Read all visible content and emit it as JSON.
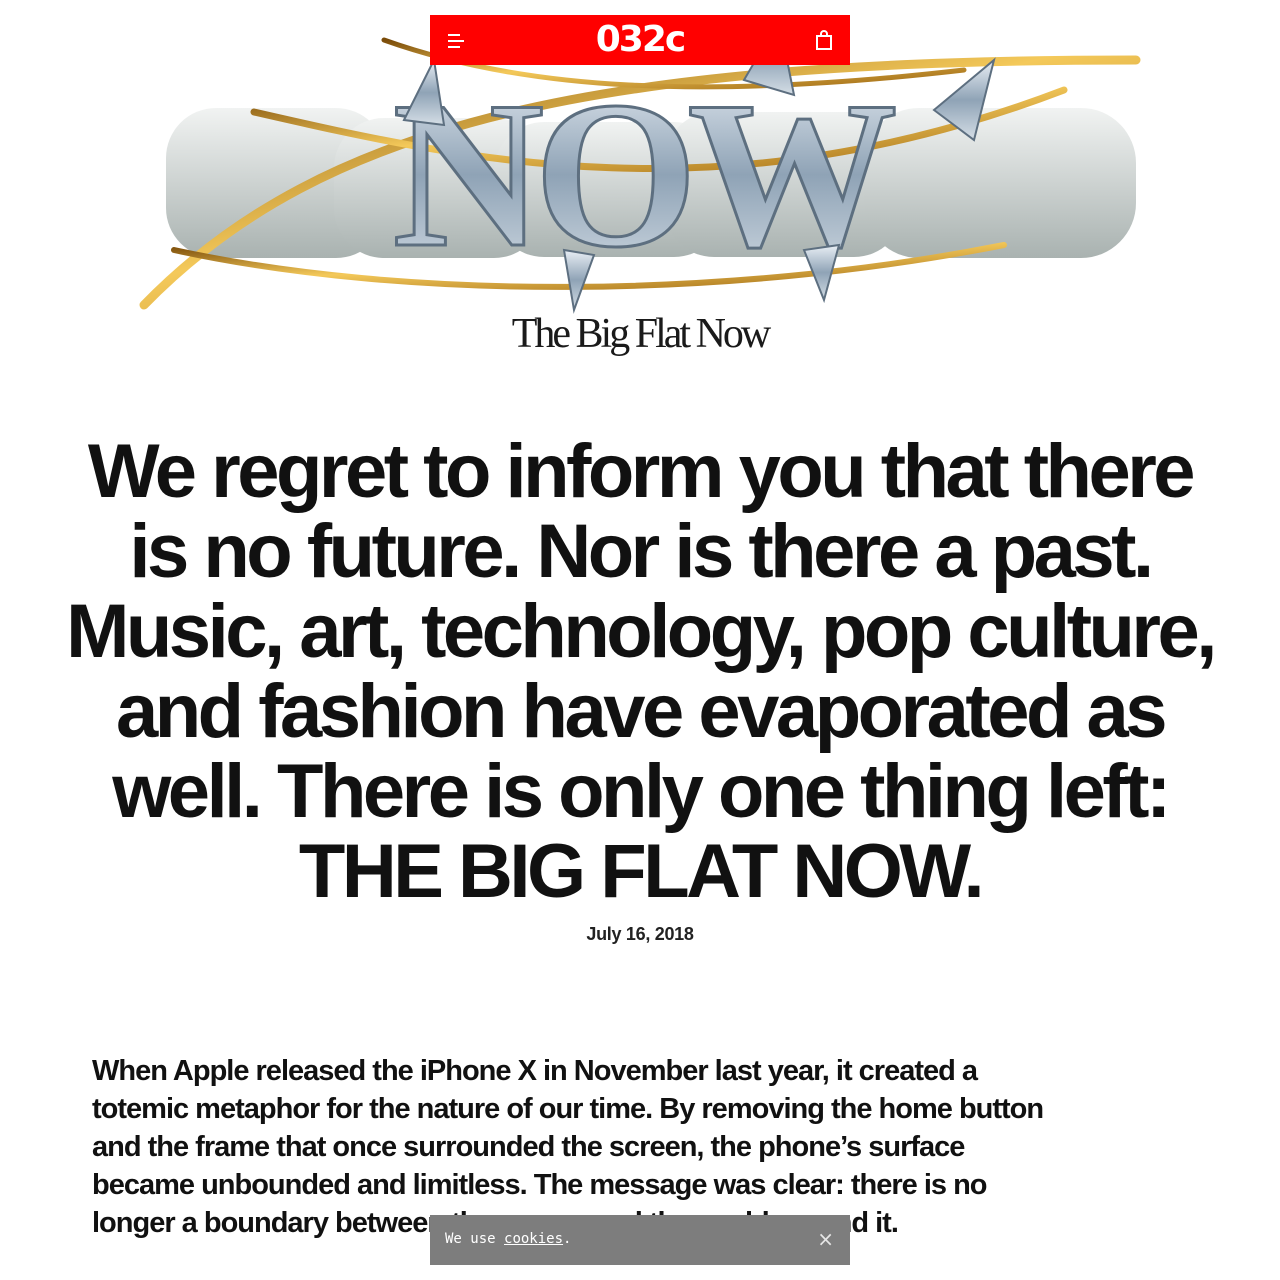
{
  "nav": {
    "logo": "032c",
    "menu_icon": "hamburger-menu-icon",
    "cart_icon": "shopping-bag-icon",
    "bar_color": "#ff0000"
  },
  "hero": {
    "artwork_text": "NOW",
    "subtitle": "The Big Flat Now"
  },
  "article": {
    "headline_lines": [
      "We regret to inform you that there",
      "is no future. Nor is there a past.",
      "Music, art, technology, pop culture,",
      "and fashion have evaporated as",
      "well. There is only one thing left:",
      "THE BIG FLAT NOW."
    ],
    "date": "July 16, 2018",
    "body_lines": [
      "When Apple released the iPhone X in November last year, it created a",
      "totemic metaphor for the nature of our time. By removing the home button",
      "and the frame that once surrounded the screen, the phone’s surface",
      "became unbounded and limitless. The message was clear: there is no",
      "longer a boundary between the screen and the world around it."
    ]
  },
  "cookie_banner": {
    "text_prefix": "We use ",
    "link_text": "cookies",
    "text_suffix": ".",
    "close_label": "×",
    "background": "#7d7d7d"
  }
}
